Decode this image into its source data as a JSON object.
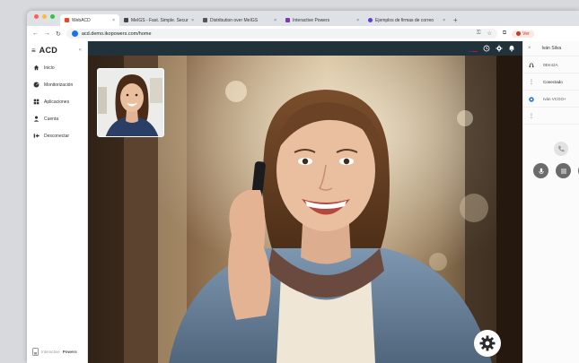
{
  "browser": {
    "traffic_colors": [
      "#ff5f57",
      "#febc2e",
      "#28c840"
    ],
    "tabs": [
      {
        "label": "WebACD",
        "favicon_color": "#e8452c",
        "active": true
      },
      {
        "label": "MeIGS - Fast. Simple. Secur",
        "favicon_color": "#444444",
        "active": false
      },
      {
        "label": "Distribution over MeIGS",
        "favicon_color": "#555555",
        "active": false
      },
      {
        "label": "Interactive Powers",
        "favicon_color": "#7b3fa0",
        "active": false
      },
      {
        "label": "Ejemplos de firmas de correo",
        "favicon_color": "#5b3fd0",
        "active": false
      }
    ],
    "new_tab": "+",
    "url": "acd.demo.ikopowers.com/home",
    "profile_label": "Ver"
  },
  "sidebar": {
    "logo": "ACD",
    "menu_icon": "menu-icon",
    "collapse": "«",
    "items": [
      {
        "label": "Inicio",
        "icon": "home-icon"
      },
      {
        "label": "Monitorización",
        "icon": "monitor-icon"
      },
      {
        "label": "Aplicaciones",
        "icon": "apps-icon"
      },
      {
        "label": "Cuenta",
        "icon": "user-icon"
      },
      {
        "label": "Desconectar",
        "icon": "logout-icon"
      }
    ],
    "powered_prefix": "Interactive",
    "powered_brand": "Powers"
  },
  "topbar": {
    "icons": [
      "language-flag-icon",
      "history-icon",
      "settings-icon",
      "bell-icon"
    ]
  },
  "right_panel": {
    "close": "×",
    "user_name": "Iván Silva",
    "extension": "0EK42A",
    "status": "Conectado",
    "status_color": "#2e7d32",
    "queue_text": "Iván VCGO+",
    "call_icon": "phone-icon",
    "buttons": [
      "mic-icon",
      "dialpad-icon",
      "more-icon"
    ]
  },
  "colors": {
    "topbar": "#22323a",
    "accent": "#1a73e8"
  }
}
